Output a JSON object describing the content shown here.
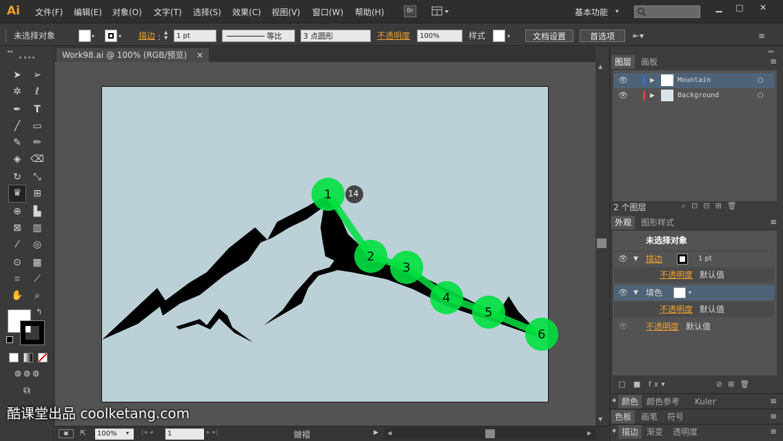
{
  "app": {
    "logo": "Ai",
    "workspace": "基本功能"
  },
  "menu": [
    "文件(F)",
    "编辑(E)",
    "对象(O)",
    "文字(T)",
    "选择(S)",
    "效果(C)",
    "视图(V)",
    "窗口(W)",
    "帮助(H)"
  ],
  "menu_extra": {
    "bridge": "Br"
  },
  "control": {
    "selection": "未选择对象",
    "stroke_label": "描边",
    "stroke_value": "1 pt",
    "stroke_profile": "等比",
    "brush": "3 点圆形",
    "opacity_label": "不透明度",
    "opacity_value": "100%",
    "style_label": "样式",
    "doc_setup": "文档设置",
    "prefs": "首选项"
  },
  "document": {
    "tab_title": "Work98.ai @ 100% (RGB/预览)",
    "close": "×"
  },
  "annotations": {
    "badge": "14",
    "steps": [
      "1",
      "2",
      "3",
      "4",
      "5",
      "6"
    ]
  },
  "layers_panel": {
    "tabs": [
      "图层",
      "画板"
    ],
    "layers": [
      {
        "name": "Mountain",
        "color": "#3a6fd8"
      },
      {
        "name": "Background",
        "color": "#e04040"
      }
    ],
    "count": "2 个图层"
  },
  "appearance_panel": {
    "tabs": [
      "外观",
      "图形样式"
    ],
    "header": "未选择对象",
    "stroke_label": "描边",
    "stroke_value": "1 pt",
    "opacity_label": "不透明度",
    "default_value": "默认值",
    "fill_label": "填色"
  },
  "collapsed_panels": [
    [
      "颜色",
      "颜色参考",
      "Kuler"
    ],
    [
      "色板",
      "画笔",
      "符号"
    ],
    [
      "描边",
      "渐变",
      "透明度"
    ]
  ],
  "status": {
    "zoom": "100%",
    "page": "1",
    "tool_label": "皴褶"
  },
  "watermark": "酷课堂出品 coolketang.com",
  "colors": {
    "accent": "#f0a030",
    "highlight": "#00e040",
    "artboard": "#bcd0d8"
  }
}
